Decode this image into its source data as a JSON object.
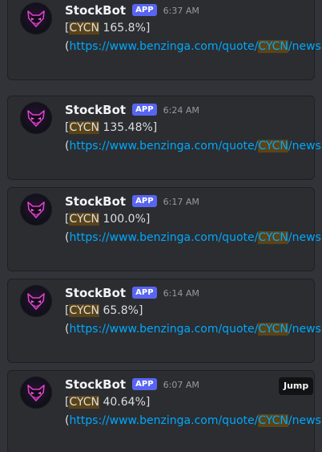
{
  "messages": [
    {
      "author": "StockBot",
      "badge": "APP",
      "time": "6:37 AM",
      "open_bracket": "[",
      "ticker": "CYCN",
      "change": " 165.8%]",
      "open_paren": "(",
      "url_prefix": "https://www.benzinga.com/quote/",
      "url_ticker": "CYCN",
      "url_suffix": "/news",
      "close_paren": ")"
    },
    {
      "author": "StockBot",
      "badge": "APP",
      "time": "6:24 AM",
      "open_bracket": "[",
      "ticker": "CYCN",
      "change": " 135.48%]",
      "open_paren": "(",
      "url_prefix": "https://www.benzinga.com/quote/",
      "url_ticker": "CYCN",
      "url_suffix": "/news",
      "close_paren": ")"
    },
    {
      "author": "StockBot",
      "badge": "APP",
      "time": "6:17 AM",
      "open_bracket": "[",
      "ticker": "CYCN",
      "change": " 100.0%]",
      "open_paren": "(",
      "url_prefix": "https://www.benzinga.com/quote/",
      "url_ticker": "CYCN",
      "url_suffix": "/news",
      "close_paren": ")"
    },
    {
      "author": "StockBot",
      "badge": "APP",
      "time": "6:14 AM",
      "open_bracket": "[",
      "ticker": "CYCN",
      "change": " 65.8%]",
      "open_paren": "(",
      "url_prefix": "https://www.benzinga.com/quote/",
      "url_ticker": "CYCN",
      "url_suffix": "/news",
      "close_paren": ")"
    },
    {
      "author": "StockBot",
      "badge": "APP",
      "time": "6:07 AM",
      "open_bracket": "[",
      "ticker": "CYCN",
      "change": " 40.64%]",
      "open_paren": "(",
      "url_prefix": "https://www.benzinga.com/quote/",
      "url_ticker": "CYCN",
      "url_suffix": "/news",
      "close_paren": ")"
    }
  ],
  "jump_label": "Jump",
  "avatar_icon": "fox-mask-icon",
  "colors": {
    "background": "#313338",
    "card": "#2b2d31",
    "badge": "#5865f2",
    "link": "#00a8fc",
    "highlight": "#5a4317",
    "avatar_glow": "#e040c8"
  }
}
